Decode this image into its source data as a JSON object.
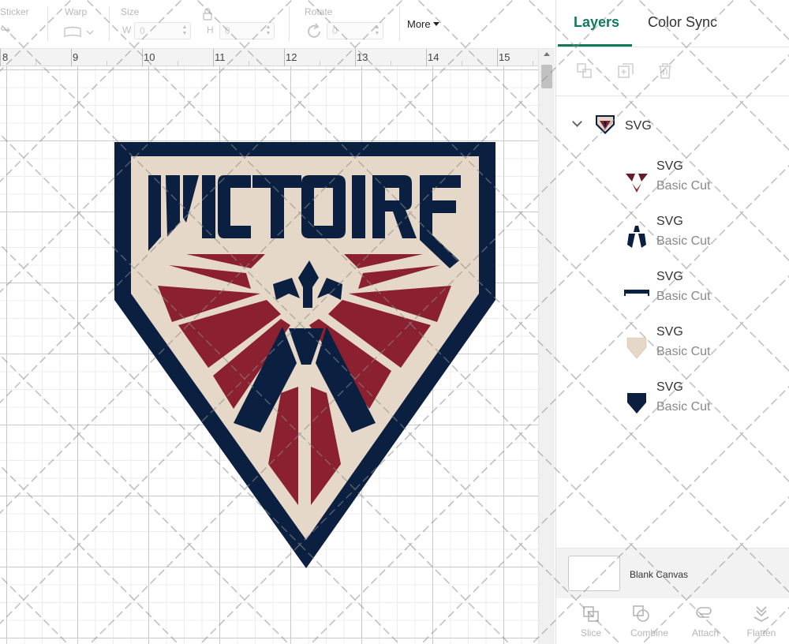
{
  "toolbar": {
    "sticker_label": "Sticker",
    "warp_label": "Warp",
    "size_label": "Size",
    "width_letter": "W",
    "width_value": "0",
    "height_letter": "H",
    "height_value": "0",
    "rotate_label": "Rotate",
    "rotate_value": "0",
    "more_label": "More"
  },
  "ruler": {
    "numbers": [
      "8",
      "9",
      "10",
      "11",
      "12",
      "13",
      "14",
      "15"
    ]
  },
  "panel": {
    "tabs": {
      "layers": "Layers",
      "color_sync": "Color Sync"
    },
    "group": {
      "name": "SVG"
    },
    "layers": [
      {
        "name": "SVG",
        "type": "Basic Cut",
        "icon": "red-wings-shape-icon"
      },
      {
        "name": "SVG",
        "type": "Basic Cut",
        "icon": "navy-bird-shape-icon"
      },
      {
        "name": "SVG",
        "type": "Basic Cut",
        "icon": "victoire-text-shape-icon"
      },
      {
        "name": "SVG",
        "type": "Basic Cut",
        "icon": "beige-shield-shape-icon"
      },
      {
        "name": "SVG",
        "type": "Basic Cut",
        "icon": "navy-shield-shape-icon"
      }
    ],
    "blank_canvas": "Blank Canvas",
    "bottom_tools": {
      "slice": "Slice",
      "combine": "Combine",
      "attach": "Attach",
      "flatten": "Flatten"
    }
  },
  "logo": {
    "text": "VICTOIRE"
  },
  "colors": {
    "navy": "#0b1f40",
    "beige": "#e6d8c8",
    "crimson": "#8a2030",
    "accent": "#0f7b5c"
  }
}
